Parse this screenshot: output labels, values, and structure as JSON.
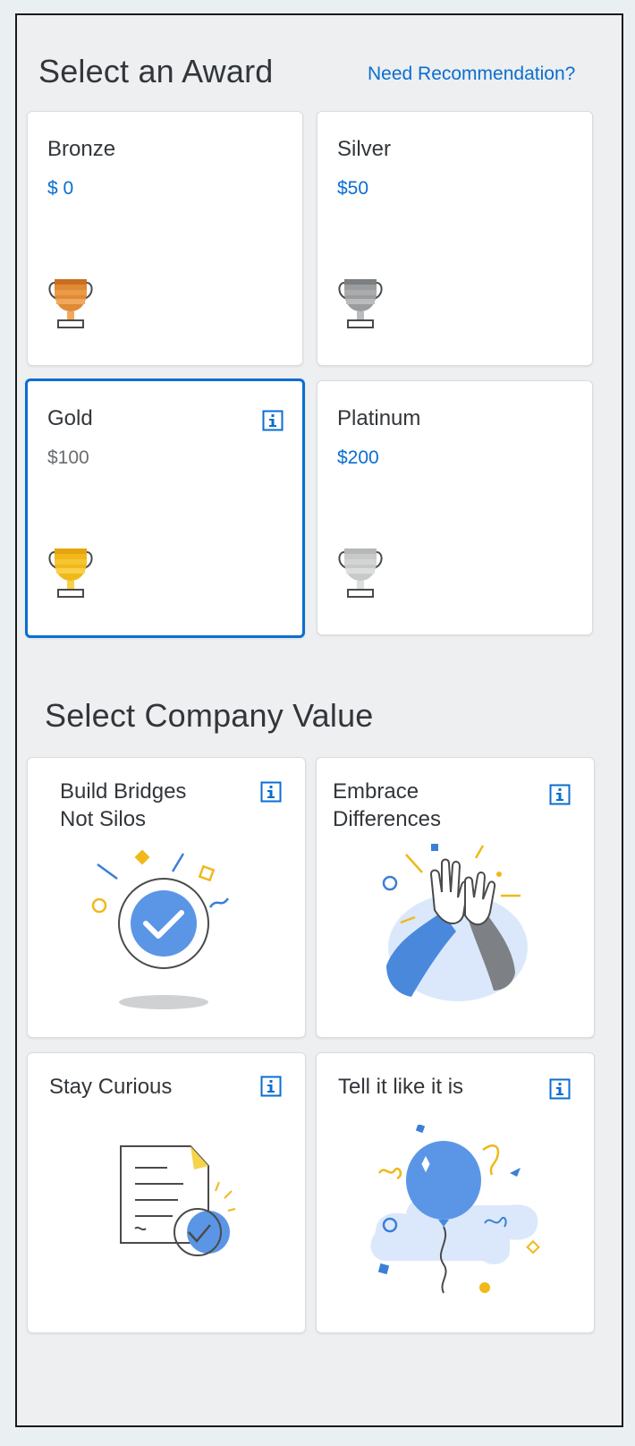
{
  "award_section": {
    "title": "Select an Award",
    "recommendation_link": "Need Recommendation?"
  },
  "awards": [
    {
      "name": "Bronze",
      "amount": "$ 0",
      "trophy": "bronze-trophy-icon"
    },
    {
      "name": "Silver",
      "amount": "$50",
      "trophy": "silver-trophy-icon"
    },
    {
      "name": "Gold",
      "amount": "$100",
      "trophy": "gold-trophy-icon",
      "selected": true
    },
    {
      "name": "Platinum",
      "amount": "$200",
      "trophy": "platinum-trophy-icon"
    }
  ],
  "value_section": {
    "title": "Select Company Value"
  },
  "values": [
    {
      "line1": "Build Bridges",
      "line2": "Not Silos",
      "illustration": "check-badge-illustration"
    },
    {
      "line1": "Embrace",
      "line2": "Differences",
      "illustration": "high-five-illustration"
    },
    {
      "line1": "Stay Curious",
      "line2": "",
      "illustration": "document-check-illustration"
    },
    {
      "line1": "Tell it like it is",
      "line2": "",
      "illustration": "balloon-illustration"
    }
  ],
  "colors": {
    "accent": "#0a6ed1",
    "bronze": "#e08a35",
    "silver": "#8f9294",
    "gold": "#f0b81a",
    "platinum": "#c8caca"
  }
}
